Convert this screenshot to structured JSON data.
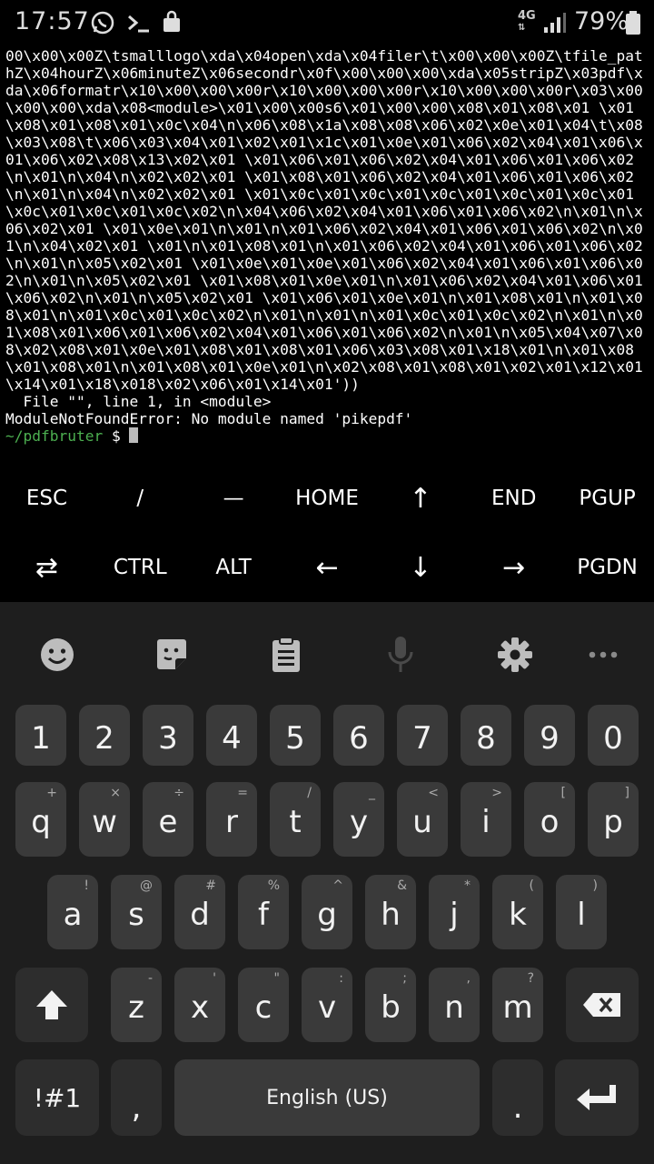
{
  "status_bar": {
    "time": "17:57",
    "network": "4G",
    "battery": "79%"
  },
  "terminal": {
    "output_lines": [
      "00\\x00\\x00Z\\tsmalllogo\\xda\\x04open\\xda\\x04filer\\t\\x00\\x00\\x00Z\\tfile_pathZ\\x04hourZ\\x06minuteZ\\x06secondr\\x0f\\x00\\x00\\x00\\xda\\x05stripZ\\x03pdf\\xda\\x06formatr\\x10\\x00\\x00\\x00r\\x10\\x00\\x00\\x00r\\x10\\x00\\x00\\x00r\\x03\\x00\\x00\\x00\\xda\\x08<module>\\x01\\x00\\x00s6\\x01\\x00\\x00\\x08\\x01\\x08\\x01 \\x01\\x08\\x01\\x08\\x01\\x0c\\x04\\n\\x06\\x08\\x1a\\x08\\x08\\x06\\x02\\x0e\\x01\\x04\\t\\x08\\x03\\x08\\t\\x06\\x03\\x04\\x01\\x02\\x01\\x1c\\x01\\x0e\\x01\\x06\\x02\\x04\\x01\\x06\\x01\\x06\\x02\\x08\\x13\\x02\\x01 \\x01\\x06\\x01\\x06\\x02\\x04\\x01\\x06\\x01\\x06\\x02\\n\\x01\\n\\x04\\n\\x02\\x02\\x01 \\x01\\x08\\x01\\x06\\x02\\x04\\x01\\x06\\x01\\x06\\x02\\n\\x01\\n\\x04\\n\\x02\\x02\\x01 \\x01\\x0c\\x01\\x0c\\x01\\x0c\\x01\\x0c\\x01\\x0c\\x01\\x0c\\x01\\x0c\\x01\\x0c\\x02\\n\\x04\\x06\\x02\\x04\\x01\\x06\\x01\\x06\\x02\\n\\x01\\n\\x06\\x02\\x01 \\x01\\x0e\\x01\\n\\x01\\n\\x01\\x06\\x02\\x04\\x01\\x06\\x01\\x06\\x02\\n\\x01\\n\\x04\\x02\\x01 \\x01\\n\\x01\\x08\\x01\\n\\x01\\x06\\x02\\x04\\x01\\x06\\x01\\x06\\x02\\n\\x01\\n\\x05\\x02\\x01 \\x01\\x0e\\x01\\x0e\\x01\\x06\\x02\\x04\\x01\\x06\\x01\\x06\\x02\\n\\x01\\n\\x05\\x02\\x01 \\x01\\x08\\x01\\x0e\\x01\\n\\x01\\x06\\x02\\x04\\x01\\x06\\x01\\x06\\x02\\n\\x01\\n\\x05\\x02\\x01 \\x01\\x06\\x01\\x0e\\x01\\n\\x01\\x08\\x01\\n\\x01\\x08\\x01\\n\\x01\\x0c\\x01\\x0c\\x02\\n\\x01\\n\\x01\\n\\x01\\x0c\\x01\\x0c\\x02\\n\\x01\\n\\x01\\x08\\x01\\x06\\x01\\x06\\x02\\x04\\x01\\x06\\x01\\x06\\x02\\n\\x01\\n\\x05\\x04\\x07\\x08\\x02\\x08\\x01\\x0e\\x01\\x08\\x01\\x08\\x01\\x06\\x03\\x08\\x01\\x18\\x01\\n\\x01\\x08\\x01\\x08\\x01\\n\\x01\\x08\\x01\\x0e\\x01\\n\\x02\\x08\\x01\\x08\\x01\\x02\\x01\\x12\\x01\\x14\\x01\\x18\\x018\\x02\\x06\\x01\\x14\\x01'))",
      "  File \"\", line 1, in <module>",
      "ModuleNotFoundError: No module named 'pikepdf'"
    ],
    "prompt_path": "~/pdfbruter",
    "prompt_symbol": "$"
  },
  "extra_keys": {
    "row1": [
      "ESC",
      "/",
      "—",
      "HOME",
      "↑",
      "END",
      "PGUP"
    ],
    "row2": [
      "⇄",
      "CTRL",
      "ALT",
      "←",
      "↓",
      "→",
      "PGDN"
    ]
  },
  "keyboard": {
    "toolbar_icons": [
      "emoji-icon",
      "sticker-icon",
      "clipboard-icon",
      "microphone-icon",
      "settings-icon",
      "more-icon"
    ],
    "number_row": [
      "1",
      "2",
      "3",
      "4",
      "5",
      "6",
      "7",
      "8",
      "9",
      "0"
    ],
    "row_q": [
      {
        "k": "q",
        "s": "+"
      },
      {
        "k": "w",
        "s": "×"
      },
      {
        "k": "e",
        "s": "÷"
      },
      {
        "k": "r",
        "s": "="
      },
      {
        "k": "t",
        "s": "/"
      },
      {
        "k": "y",
        "s": "_"
      },
      {
        "k": "u",
        "s": "<"
      },
      {
        "k": "i",
        "s": ">"
      },
      {
        "k": "o",
        "s": "["
      },
      {
        "k": "p",
        "s": "]"
      }
    ],
    "row_a": [
      {
        "k": "a",
        "s": "!"
      },
      {
        "k": "s",
        "s": "@"
      },
      {
        "k": "d",
        "s": "#"
      },
      {
        "k": "f",
        "s": "%"
      },
      {
        "k": "g",
        "s": "^"
      },
      {
        "k": "h",
        "s": "&"
      },
      {
        "k": "j",
        "s": "*"
      },
      {
        "k": "k",
        "s": "("
      },
      {
        "k": "l",
        "s": ")"
      }
    ],
    "row_z": [
      {
        "k": "z",
        "s": "-"
      },
      {
        "k": "x",
        "s": "'"
      },
      {
        "k": "c",
        "s": "\""
      },
      {
        "k": "v",
        "s": ":"
      },
      {
        "k": "b",
        "s": ";"
      },
      {
        "k": "n",
        "s": ","
      },
      {
        "k": "m",
        "s": "?"
      }
    ],
    "symbols_label": "!#1",
    "comma_label": ",",
    "space_label": "English (US)",
    "period_label": "."
  }
}
